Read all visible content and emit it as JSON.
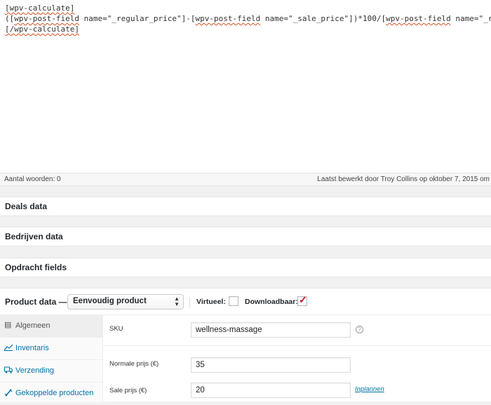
{
  "editor": {
    "line1": "[wpv-calculate]",
    "line2_a": "([",
    "line2_b": "wpv-post-field",
    "line2_c": " name=\"_regular_price\"]-[",
    "line2_d": "wpv-post-field",
    "line2_e": " name=\"_sale_price\"])*100/[",
    "line2_f": "wpv-post-field",
    "line2_g": " name=\"_regular_price\"]",
    "line3": "[/wpv-calculate]"
  },
  "status": {
    "word_count": "Aantal woorden: 0",
    "last_edited": "Laatst bewerkt door Troy Collins op oktober 7, 2015 om"
  },
  "metaboxes": [
    "Deals data",
    "Bedrijven data",
    "Opdracht fields"
  ],
  "product_data": {
    "title": "Product data —",
    "type_select": "Eenvoudig product",
    "virtual_label": "Virtueel:",
    "virtual_checked": false,
    "downloadable_label": "Downloadbaar:",
    "downloadable_checked": true,
    "tabs": [
      {
        "label": "Algemeen",
        "icon": "grid-icon"
      },
      {
        "label": "Inventaris",
        "icon": "chart-icon"
      },
      {
        "label": "Verzending",
        "icon": "truck-icon"
      },
      {
        "label": "Gekoppelde producten",
        "icon": "link-icon"
      }
    ],
    "fields": {
      "sku_label": "SKU",
      "sku_value": "wellness-massage",
      "regular_label": "Normale prijs (€)",
      "regular_value": "35",
      "sale_label": "Sale prijs (€)",
      "sale_value": "20",
      "schedule_link": "Inplannen"
    }
  },
  "colors": {
    "accent": "#0073aa",
    "check": "#d0021b"
  }
}
